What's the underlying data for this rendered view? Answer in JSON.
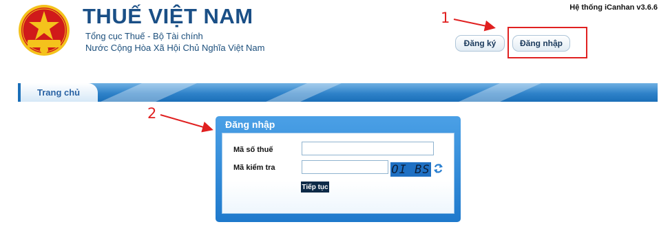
{
  "header": {
    "site_title": "THUẾ VIỆT NAM",
    "subtitle_1": "Tổng cục Thuế - Bộ Tài chính",
    "subtitle_2": "Nước Cộng Hòa Xã Hội Chủ Nghĩa Việt Nam",
    "emblem_text": "THUẾ NHÀ NƯỚC",
    "version": "Hệ thống iCanhan v3.6.6",
    "register_label": "Đăng ký",
    "login_label": "Đăng nhập"
  },
  "annotations": {
    "step_1": "1",
    "step_2": "2",
    "color": "#e02020"
  },
  "nav": {
    "home_label": "Trang chủ"
  },
  "login_form": {
    "title": "Đăng nhập",
    "tax_code_label": "Mã số thuế",
    "tax_code_value": "",
    "captcha_label": "Mã kiểm tra",
    "captcha_value": "",
    "captcha_text": "OI BS",
    "submit_label": "Tiếp tục"
  },
  "icons": {
    "emblem": "national-emblem-icon",
    "refresh": "refresh-icon"
  },
  "colors": {
    "brand_blue": "#1a4f86",
    "nav_blue": "#2f82c9",
    "panel_blue": "#1e79cc",
    "emblem_red": "#d01a1a",
    "emblem_gold": "#f4c21c"
  }
}
